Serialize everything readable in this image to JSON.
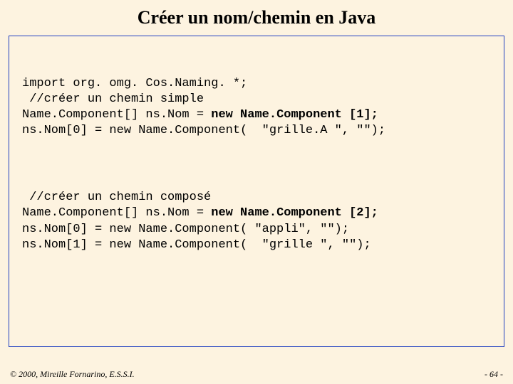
{
  "title": "Créer un nom/chemin en Java",
  "code1": {
    "l1": "import org. omg. Cos.Naming. *;",
    "l2": " //créer un chemin simple",
    "l3a": "Name.Component[] ns.Nom = ",
    "l3b": "new Name.Component [1];",
    "l4": "ns.Nom[0] = new Name.Component(  \"grille.A \", \"\");"
  },
  "code2": {
    "l1": " //créer un chemin composé",
    "l2a": "Name.Component[] ns.Nom = ",
    "l2b": "new Name.Component [2];",
    "l3": "ns.Nom[0] = new Name.Component( \"appli\", \"\");",
    "l4": "ns.Nom[1] = new Name.Component(  \"grille \", \"\");"
  },
  "footer": {
    "left": "© 2000, Mireille Fornarino, E.S.S.I.",
    "right": "- 64 -"
  }
}
